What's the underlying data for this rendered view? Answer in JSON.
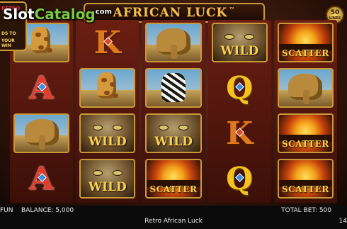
{
  "watermark": {
    "part1": "Slot",
    "part2": "Catalog",
    "part3": "com"
  },
  "title": "AFRICAN LUCK",
  "title_mark": "™",
  "logo_box": {
    "label": "RETRO",
    "line1": "DS TO",
    "line2": "YOUR WIN"
  },
  "lines_badge": {
    "number": "50",
    "label": "LINES"
  },
  "reels": [
    [
      {
        "type": "animal",
        "animal": "giraffe",
        "icon": "giraffe-icon"
      },
      {
        "type": "letter",
        "letter": "A",
        "gem": "blue"
      },
      {
        "type": "animal",
        "animal": "elephant",
        "icon": "elephant-icon"
      },
      {
        "type": "letter",
        "letter": "A",
        "gem": "blue"
      }
    ],
    [
      {
        "type": "letter",
        "letter": "K",
        "gem": "red"
      },
      {
        "type": "animal",
        "animal": "giraffe",
        "icon": "giraffe-icon"
      },
      {
        "type": "wild",
        "text": "WILD"
      },
      {
        "type": "wild",
        "text": "WILD"
      }
    ],
    [
      {
        "type": "animal",
        "animal": "elephant",
        "icon": "elephant-icon"
      },
      {
        "type": "animal",
        "animal": "zebra",
        "icon": "zebra-icon"
      },
      {
        "type": "wild",
        "text": "WILD"
      },
      {
        "type": "scatter",
        "text": "SCATTER"
      }
    ],
    [
      {
        "type": "wild",
        "text": "WILD"
      },
      {
        "type": "letter",
        "letter": "Q",
        "gem": "blue"
      },
      {
        "type": "letter",
        "letter": "K",
        "gem": "red"
      },
      {
        "type": "letter",
        "letter": "Q",
        "gem": "blue"
      }
    ],
    [
      {
        "type": "scatter",
        "text": "SCATTER"
      },
      {
        "type": "animal",
        "animal": "elephant",
        "icon": "elephant-icon"
      },
      {
        "type": "scatter",
        "text": "SCATTER"
      },
      {
        "type": "scatter",
        "text": "SCATTER"
      }
    ]
  ],
  "bottom": {
    "mode": "FUN",
    "balance": "BALANCE: 5,000",
    "game_name": "Retro African Luck",
    "total_bet": "TOTAL BET: 500",
    "corner": "14"
  }
}
